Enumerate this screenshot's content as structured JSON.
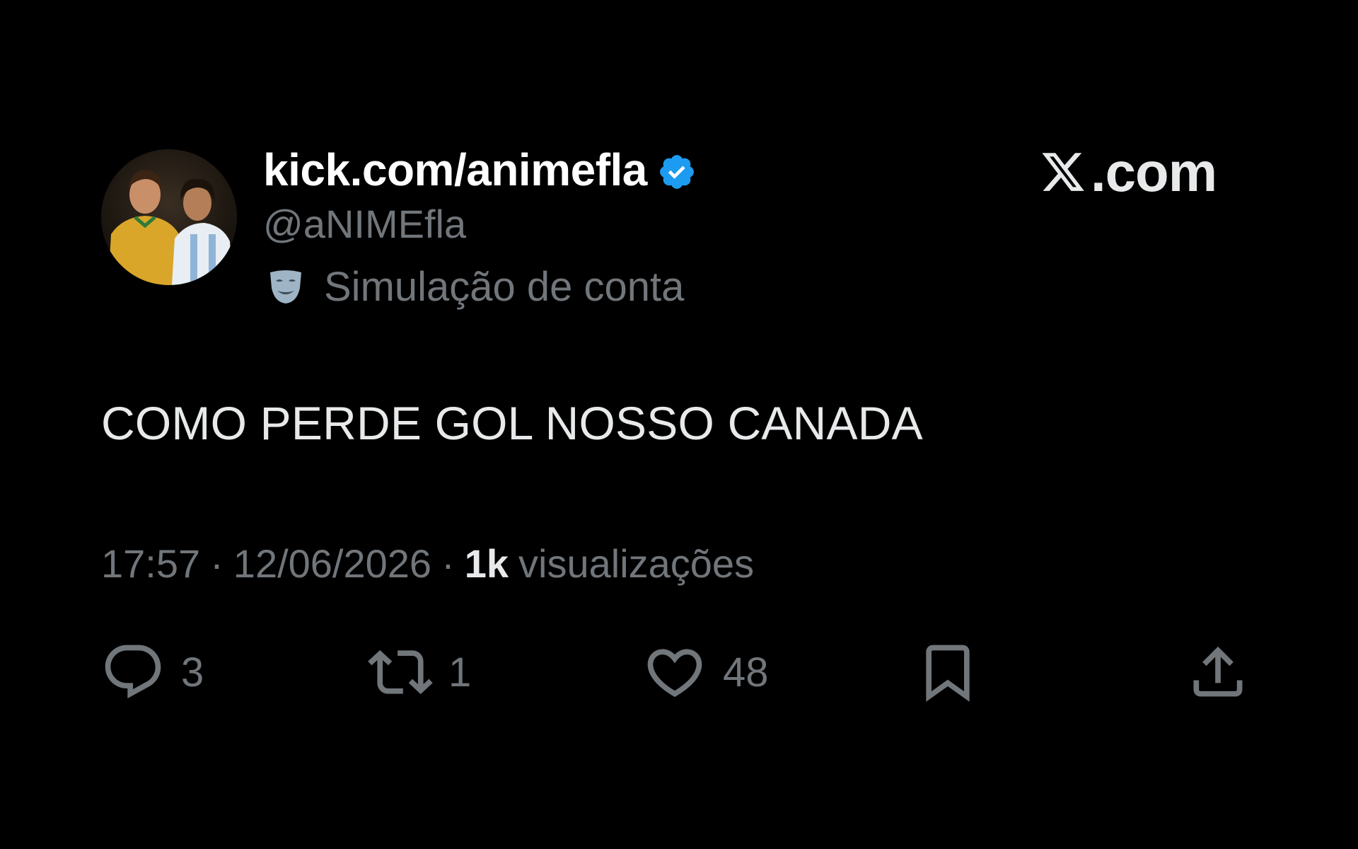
{
  "colors": {
    "background": "#000000",
    "primary_text": "#e7e9ea",
    "secondary_text": "#71767b",
    "verified_blue": "#1d9bf0"
  },
  "author": {
    "display_name": "kick.com/animefla",
    "handle": "@aNIMEfla",
    "verified": true,
    "label": "Simulação de conta",
    "label_icon": "performing-arts-mask-icon"
  },
  "brand": {
    "text": ".com",
    "icon": "x-logo-icon"
  },
  "tweet": {
    "text": "COMO PERDE GOL NOSSO CANADA"
  },
  "meta": {
    "time": "17:57",
    "separator": "·",
    "date": "12/06/2026",
    "views_count": "1k",
    "views_label": "visualizações"
  },
  "actions": {
    "replies": "3",
    "reposts": "1",
    "likes": "48"
  }
}
